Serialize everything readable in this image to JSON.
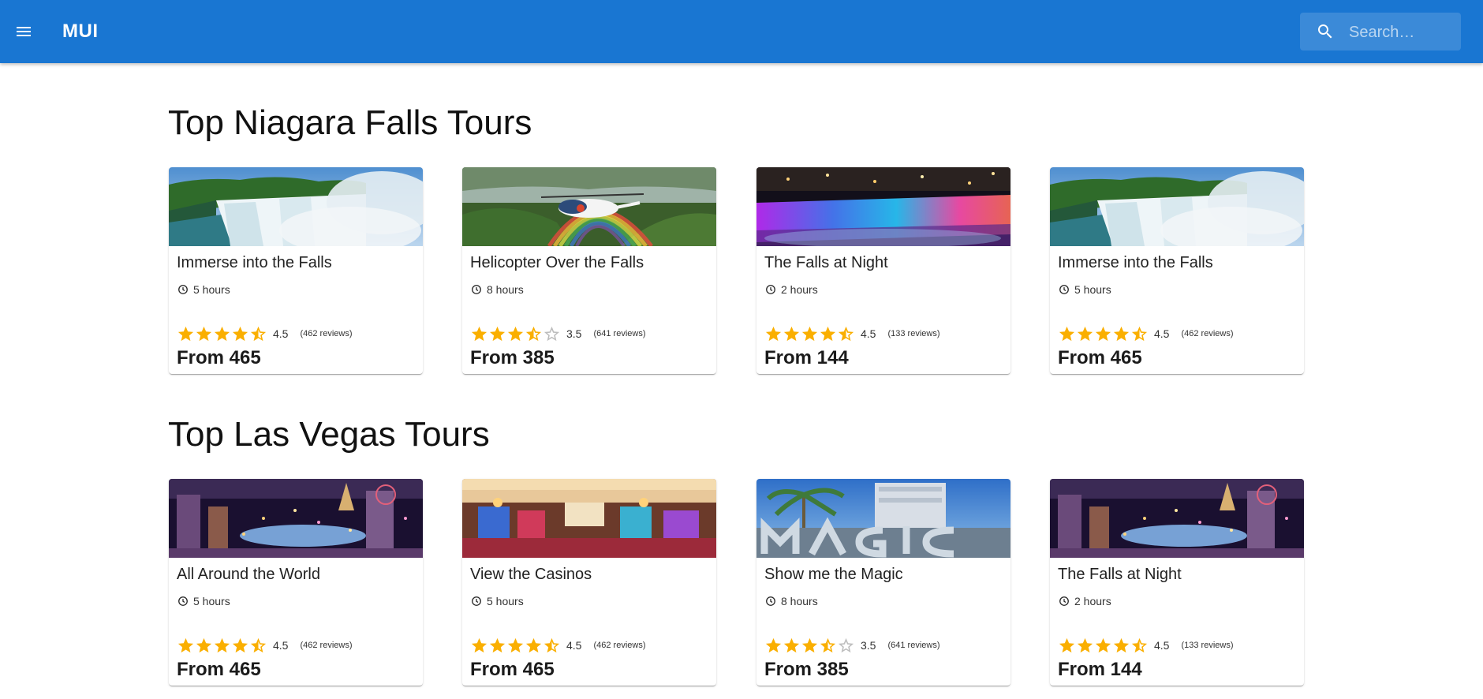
{
  "header": {
    "brand": "MUI",
    "search_placeholder": "Search…",
    "colors": {
      "appbar": "#1976d2",
      "star": "#faaf00",
      "star_empty": "#bdbdbd"
    }
  },
  "sections": [
    {
      "title": "Top Niagara Falls Tours",
      "tours": [
        {
          "name": "Immerse into the Falls",
          "duration": "5 hours",
          "rating": 4.5,
          "rating_label": "4.5",
          "reviews": "(462 reviews)",
          "price": "From 465",
          "image": "niagara-falls-daytime"
        },
        {
          "name": "Helicopter Over the Falls",
          "duration": "8 hours",
          "rating": 3.5,
          "rating_label": "3.5",
          "reviews": "(641 reviews)",
          "price": "From 385",
          "image": "helicopter-rainbow-falls"
        },
        {
          "name": "The Falls at Night",
          "duration": "2 hours",
          "rating": 4.5,
          "rating_label": "4.5",
          "reviews": "(133 reviews)",
          "price": "From 144",
          "image": "niagara-falls-night-lights"
        },
        {
          "name": "Immerse into the Falls",
          "duration": "5 hours",
          "rating": 4.5,
          "rating_label": "4.5",
          "reviews": "(462 reviews)",
          "price": "From 465",
          "image": "niagara-falls-daytime"
        }
      ]
    },
    {
      "title": "Top Las Vegas Tours",
      "tours": [
        {
          "name": "All Around the World",
          "duration": "5 hours",
          "rating": 4.5,
          "rating_label": "4.5",
          "reviews": "(462 reviews)",
          "price": "From 465",
          "image": "las-vegas-strip-night"
        },
        {
          "name": "View the Casinos",
          "duration": "5 hours",
          "rating": 4.5,
          "rating_label": "4.5",
          "reviews": "(462 reviews)",
          "price": "From 465",
          "image": "casino-interior"
        },
        {
          "name": "Show me the Magic",
          "duration": "8 hours",
          "rating": 3.5,
          "rating_label": "3.5",
          "reviews": "(641 reviews)",
          "price": "From 385",
          "image": "magic-sign-palms"
        },
        {
          "name": "The Falls at Night",
          "duration": "2 hours",
          "rating": 4.5,
          "rating_label": "4.5",
          "reviews": "(133 reviews)",
          "price": "From 144",
          "image": "las-vegas-strip-night"
        }
      ]
    }
  ]
}
